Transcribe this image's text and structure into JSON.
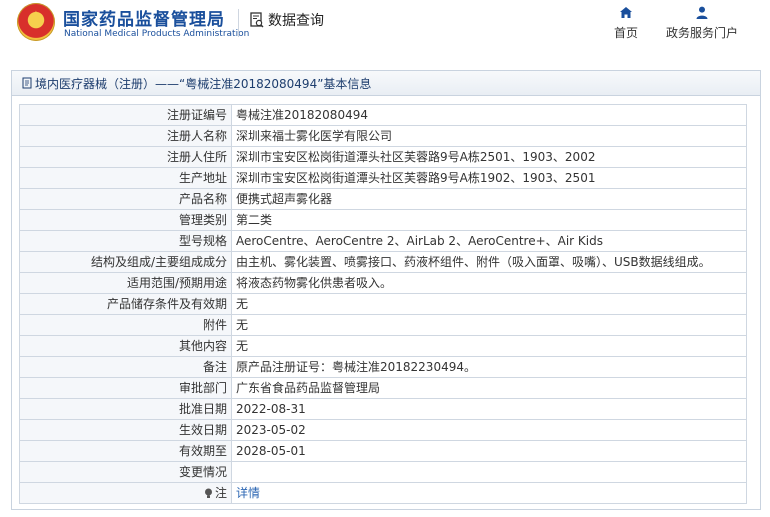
{
  "header": {
    "logo_cn": "国家药品监督管理局",
    "logo_en": "National Medical Products Administration",
    "query_label": "数据查询",
    "nav": [
      {
        "label": "首页",
        "icon": "home-icon"
      },
      {
        "label": "政务服务门户",
        "icon": "user-icon"
      }
    ]
  },
  "panel": {
    "title": "境内医疗器械（注册）——“粤械注准20182080494”基本信息"
  },
  "rows": [
    {
      "label": "注册证编号",
      "value": "粤械注准20182080494"
    },
    {
      "label": "注册人名称",
      "value": "深圳来福士雾化医学有限公司"
    },
    {
      "label": "注册人住所",
      "value": "深圳市宝安区松岗街道潭头社区芙蓉路9号A栋2501、1903、2002"
    },
    {
      "label": "生产地址",
      "value": "深圳市宝安区松岗街道潭头社区芙蓉路9号A栋1902、1903、2501"
    },
    {
      "label": "产品名称",
      "value": "便携式超声雾化器"
    },
    {
      "label": "管理类别",
      "value": "第二类"
    },
    {
      "label": "型号规格",
      "value": "AeroCentre、AeroCentre 2、AirLab 2、AeroCentre+、Air Kids"
    },
    {
      "label": "结构及组成/主要组成成分",
      "value": "由主机、雾化装置、喷雾接口、药液杯组件、附件（吸入面罩、吸嘴）、USB数据线组成。"
    },
    {
      "label": "适用范围/预期用途",
      "value": "将液态药物雾化供患者吸入。"
    },
    {
      "label": "产品储存条件及有效期",
      "value": "无"
    },
    {
      "label": "附件",
      "value": "无"
    },
    {
      "label": "其他内容",
      "value": "无"
    },
    {
      "label": "备注",
      "value": "原产品注册证号：粤械注准20182230494。"
    },
    {
      "label": "审批部门",
      "value": "广东省食品药品监督管理局"
    },
    {
      "label": "批准日期",
      "value": "2022-08-31"
    },
    {
      "label": "生效日期",
      "value": "2023-05-02"
    },
    {
      "label": "有效期至",
      "value": "2028-05-01"
    },
    {
      "label": "变更情况",
      "value": ""
    }
  ],
  "note_row": {
    "label": "注",
    "link": "详情"
  },
  "colors": {
    "brand": "#1a4f9c",
    "link": "#2b66b3"
  }
}
